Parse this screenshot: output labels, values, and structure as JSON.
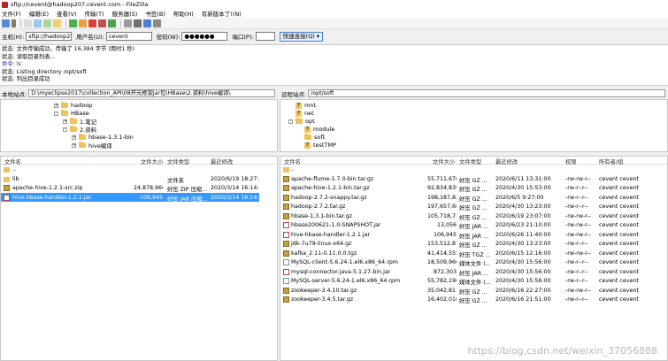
{
  "window": {
    "title": "sftp://cevent@hadoop207.cevent.com - FileZilla"
  },
  "menu": [
    "文件(F)",
    "编辑(E)",
    "查看(V)",
    "传输(T)",
    "服务器(S)",
    "书签(B)",
    "帮助(H)",
    "有新版本了!(N)"
  ],
  "quickconnect": {
    "host_label": "主机(H):",
    "host_value": "sftp://hadoop207.",
    "user_label": "用户名(U):",
    "user_value": "cevent",
    "pass_label": "密码(W):",
    "pass_value": "●●●●●●",
    "port_label": "端口(P):",
    "port_value": "",
    "button_label": "快速连接(Q)"
  },
  "log": [
    "状态: 文件传输成功，传输了 16,384 字节 (用时1 秒)",
    "状态: 读取目录列表...",
    "命令: ls",
    "状态: Listing directory /opt/soft",
    "状态: 列出目录成功"
  ],
  "local": {
    "site_label": "本地站点:",
    "site_path": "D:\\myeclipse2017\\collection_API\\08开元框架jar包\\HBase\\2.资料\\hive编译\\",
    "tree": [
      {
        "label": "hadoop",
        "level": 0,
        "expander": "+"
      },
      {
        "label": "HBase",
        "level": 0,
        "expander": "-"
      },
      {
        "label": "1.笔记",
        "level": 1,
        "expander": "+"
      },
      {
        "label": "2.资料",
        "level": 1,
        "expander": "-"
      },
      {
        "label": "hbase-1.3.1-bin",
        "level": 2,
        "expander": "+"
      },
      {
        "label": "hive编译",
        "level": 2,
        "expander": "+"
      }
    ],
    "columns": [
      "文件名",
      "文件大小",
      "文件类型",
      "最近修改"
    ],
    "files": [
      {
        "name": "..",
        "size": "",
        "type": "",
        "modified": "",
        "icon": "dir",
        "selected": false
      },
      {
        "name": "lib",
        "size": "",
        "type": "文件夹",
        "modified": "2020/6/19 18:27:...",
        "icon": "dir",
        "selected": false
      },
      {
        "name": "apache-hive-1.2.1-src.zip",
        "size": "24,878,966",
        "type": "好压 ZIP 压缩...",
        "modified": "2020/3/14 16:14:...",
        "icon": "zip",
        "selected": false
      },
      {
        "name": "hive-hbase-handler-1.2.1.jar",
        "size": "106,945",
        "type": "好压 JAR 压缩...",
        "modified": "2020/3/14 16:14:...",
        "icon": "jar",
        "selected": true
      }
    ]
  },
  "remote": {
    "site_label": "远程站点:",
    "site_path": "/opt/soft",
    "tree": [
      {
        "label": "mnt",
        "level": 0,
        "kind": "q"
      },
      {
        "label": "net",
        "level": 0,
        "kind": "q"
      },
      {
        "label": "opt",
        "level": 0,
        "kind": "folder",
        "expander": "-"
      },
      {
        "label": "module",
        "level": 1,
        "kind": "q"
      },
      {
        "label": "soft",
        "level": 1,
        "kind": "folder"
      },
      {
        "label": "testTMP",
        "level": 1,
        "kind": "q"
      }
    ],
    "columns": [
      "文件名",
      "文件大小",
      "文件类型",
      "最近修改",
      "权限",
      "所有者/组"
    ],
    "files": [
      {
        "name": "..",
        "size": "",
        "type": "",
        "modified": "",
        "perm": "",
        "owner": "",
        "icon": "dir"
      },
      {
        "name": "apache-flume-1.7.0-bin.tar.gz",
        "size": "55,711,670",
        "type": "好压 GZ ...",
        "modified": "2020/6/11 13:31:00",
        "perm": "-rw-rw-r--",
        "owner": "cevent cevent",
        "icon": "zip"
      },
      {
        "name": "apache-hive-1.2.1-bin.tar.gz",
        "size": "92,834,839",
        "type": "好压 GZ ...",
        "modified": "2020/4/30 15:53:00",
        "perm": "-rw-r--r--",
        "owner": "cevent cevent",
        "icon": "zip"
      },
      {
        "name": "hadoop-2.7.2-snappy.tar.gz",
        "size": "198,187,829",
        "type": "好压 GZ ...",
        "modified": "2020/6/5 9:27:00",
        "perm": "-rw-r--r--",
        "owner": "cevent cevent",
        "icon": "zip"
      },
      {
        "name": "hadoop-2.7.2.tar.gz",
        "size": "197,657,687",
        "type": "好压 GZ ...",
        "modified": "2020/4/30 13:23:00",
        "perm": "-rw-r--r--",
        "owner": "cevent cevent",
        "icon": "zip"
      },
      {
        "name": "hbase-1.3.1-bin.tar.gz",
        "size": "105,718,722",
        "type": "好压 GZ ...",
        "modified": "2020/6/19 23:07:00",
        "perm": "-rw-rw-r--",
        "owner": "cevent cevent",
        "icon": "zip"
      },
      {
        "name": "hbase200621-1.0-SNAPSHOT.jar",
        "size": "13,056",
        "type": "好压 JAR ...",
        "modified": "2020/6/23 21:10:00",
        "perm": "-rw-rw-r--",
        "owner": "cevent cevent",
        "icon": "jar"
      },
      {
        "name": "hive-hbase-handler-1.2.1.jar",
        "size": "106,945",
        "type": "好压 JAR ...",
        "modified": "2020/6/26 11:40:00",
        "perm": "-rw-rw-r--",
        "owner": "cevent cevent",
        "icon": "jar"
      },
      {
        "name": "jdk-7u79-linux-x64.gz",
        "size": "153,512,879",
        "type": "好压 GZ ...",
        "modified": "2020/4/30 13:23:00",
        "perm": "-rw-r--r--",
        "owner": "cevent cevent",
        "icon": "zip"
      },
      {
        "name": "kafka_2.11-0.11.0.0.tgz",
        "size": "41,414,555",
        "type": "好压 TGZ ...",
        "modified": "2020/6/15 12:16:00",
        "perm": "-rw-rw-r--",
        "owner": "cevent cevent",
        "icon": "zip"
      },
      {
        "name": "MySQL-client-5.6.24-1.el6.x86_64.rpm",
        "size": "18,509,960",
        "type": "媒体文件 (...",
        "modified": "2020/4/30 15:56:00",
        "perm": "-rw-r--r--",
        "owner": "cevent cevent",
        "icon": "file"
      },
      {
        "name": "mysql-connector-java-5.1.27-bin.jar",
        "size": "872,303",
        "type": "好压 JAR ...",
        "modified": "2020/4/30 15:56:00",
        "perm": "-rw-r--r--",
        "owner": "cevent cevent",
        "icon": "jar"
      },
      {
        "name": "MySQL-server-5.6.24-1.el6.x86_64.rpm",
        "size": "55,782,196",
        "type": "媒体文件 (...",
        "modified": "2020/4/30 15:56:00",
        "perm": "-rw-r--r--",
        "owner": "cevent cevent",
        "icon": "file"
      },
      {
        "name": "zookeeper-3.4.10.tar.gz",
        "size": "35,042,811",
        "type": "好压 GZ ...",
        "modified": "2020/6/16 22:27:00",
        "perm": "-rw-rw-r--",
        "owner": "cevent cevent",
        "icon": "zip"
      },
      {
        "name": "zookeeper-3.4.5.tar.gz",
        "size": "16,402,010",
        "type": "好压 GZ ...",
        "modified": "2020/6/16 21:51:00",
        "perm": "-rw-r--r--",
        "owner": "cevent cevent",
        "icon": "zip"
      }
    ]
  },
  "watermark": "https://blog.csdn.net/weixin_37056888"
}
